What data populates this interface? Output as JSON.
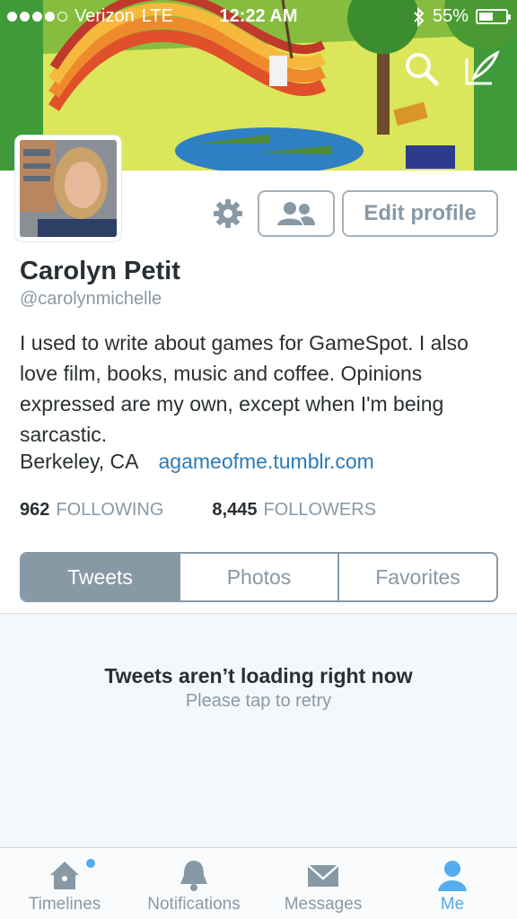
{
  "status_bar": {
    "carrier": "Verizon",
    "network": "LTE",
    "time": "12:22 AM",
    "battery": "55%",
    "battery_level": 0.55
  },
  "header": {
    "search_icon": "search-icon",
    "compose_icon": "compose-icon"
  },
  "profile": {
    "name": "Carolyn Petit",
    "handle": "@carolynmichelle",
    "bio": "I used to write about games for GameSpot. I also love film, books, music and coffee. Opinions expressed are my own, except when I'm being sarcastic.",
    "location": "Berkeley, CA",
    "website": "agameofme.tumblr.com",
    "following_count": "962",
    "following_label": "FOLLOWING",
    "followers_count": "8,445",
    "followers_label": "FOLLOWERS",
    "edit_label": "Edit profile"
  },
  "tabs": {
    "items": [
      {
        "label": "Tweets",
        "active": true
      },
      {
        "label": "Photos",
        "active": false
      },
      {
        "label": "Favorites",
        "active": false
      }
    ]
  },
  "feed": {
    "error_title": "Tweets aren’t loading right now",
    "error_sub": "Please tap to retry"
  },
  "tab_bar": {
    "items": [
      {
        "label": "Timelines",
        "icon": "home-icon"
      },
      {
        "label": "Notifications",
        "icon": "bell-icon"
      },
      {
        "label": "Messages",
        "icon": "envelope-icon"
      },
      {
        "label": "Me",
        "icon": "person-icon"
      }
    ]
  },
  "colors": {
    "accent": "#55acee",
    "link": "#2b7bb9",
    "muted": "#8899a6"
  }
}
